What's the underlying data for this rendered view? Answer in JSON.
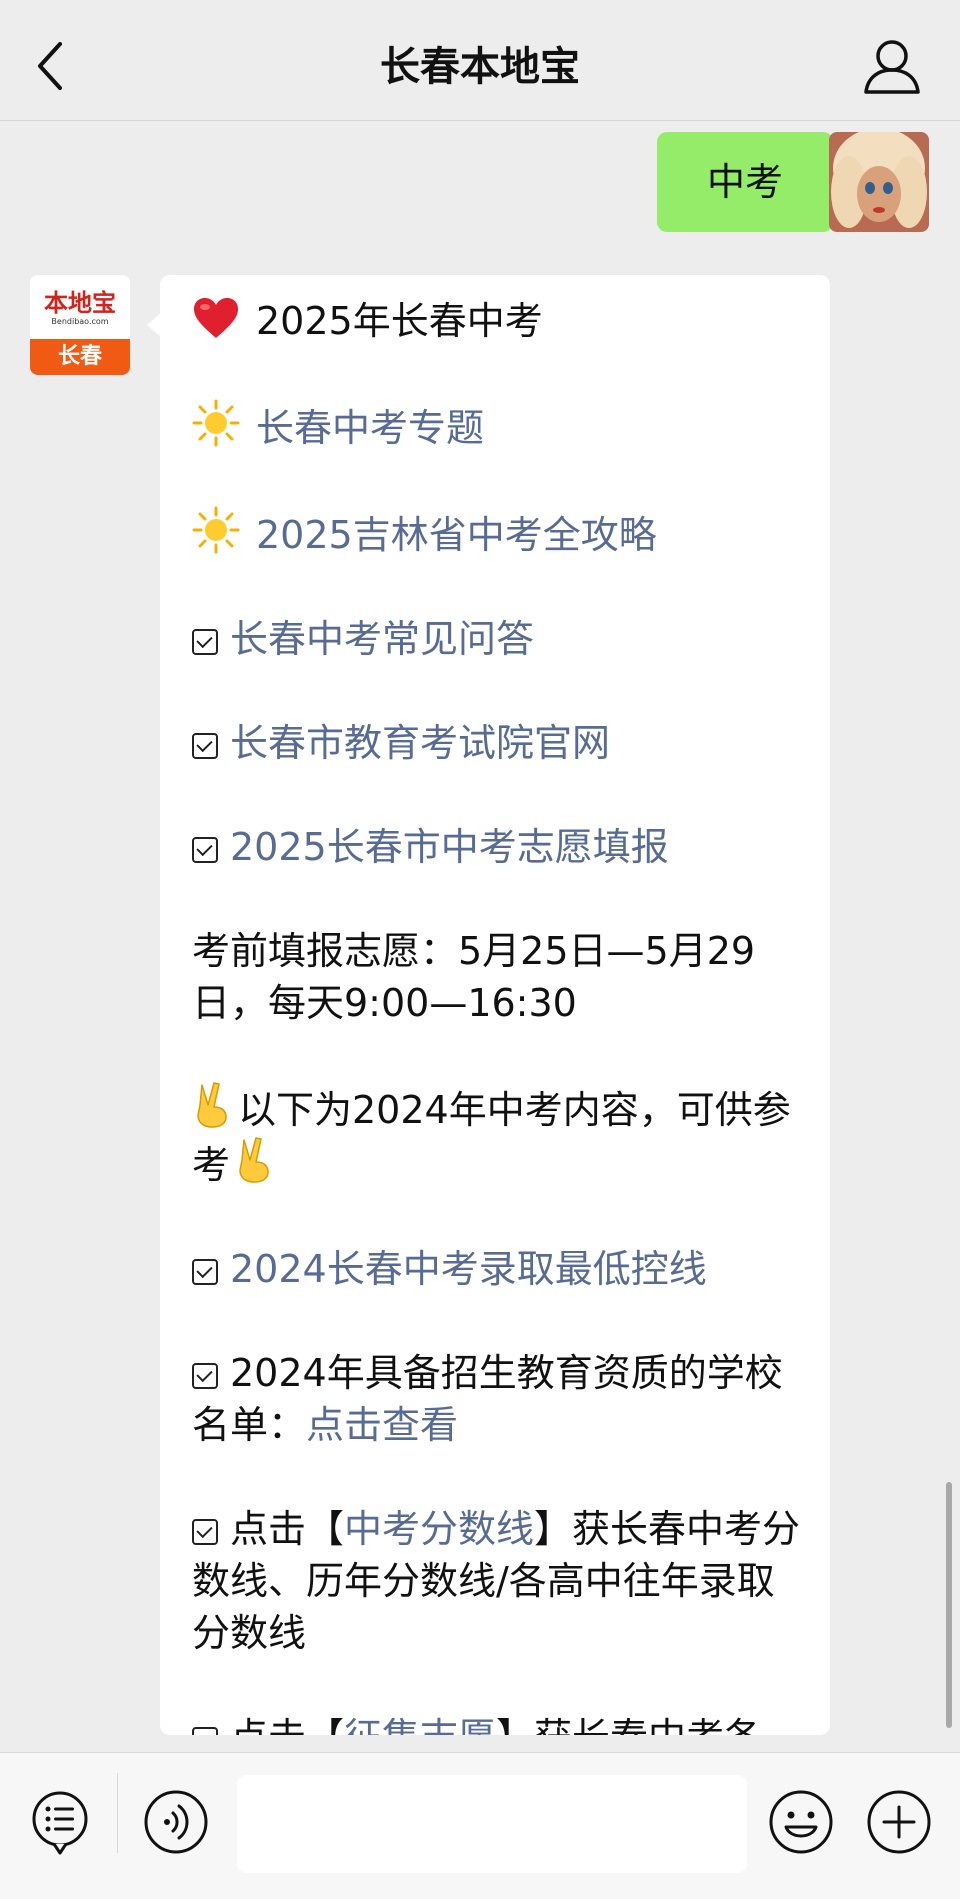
{
  "header": {
    "title": "长春本地宝",
    "back_icon": "chevron-left-icon",
    "profile_icon": "person-icon"
  },
  "messages": {
    "user": {
      "text": "中考",
      "bubble_color": "#95ec69"
    },
    "bot": {
      "avatar": {
        "logo_text": "本地宝",
        "logo_url": "Bendibao.com",
        "city": "长春"
      },
      "bubble_color": "#ffffff",
      "link_color": "#576b95",
      "lines": {
        "l1": "2025年长春中考",
        "l2": "长春中考专题",
        "l3": "2025吉林省中考全攻略",
        "l4": "长春中考常见问答",
        "l5": "长春市教育考试院官网",
        "l6": "2025长春市中考志愿填报",
        "l7": " 考前填报志愿：5月25日—5月29日，每天9:00—16:30",
        "l8": "以下为2024年中考内容，可供参考",
        "l9": "2024长春中考录取最低控线",
        "l10_text": "2024年具备招生教育资质的学校名单：",
        "l10_link": "点击查看",
        "l11_pre": "点击【",
        "l11_link": "中考分数线",
        "l11_post": "】获长春中考分数线、历年分数线/各高中往年录取分数线",
        "l12_pre": "点击【",
        "l12_link": "征集志愿",
        "l12_post": "】获长春中考各"
      },
      "icons": {
        "heart": "red-heart-icon",
        "sun": "sun-icon",
        "checkbox": "checkbox-icon",
        "victory": "victory-hand-icon"
      }
    }
  },
  "input_bar": {
    "menu_icon": "menu-list-icon",
    "voice_icon": "voice-icon",
    "emoji_icon": "smiley-icon",
    "plus_icon": "plus-icon",
    "placeholder": ""
  }
}
